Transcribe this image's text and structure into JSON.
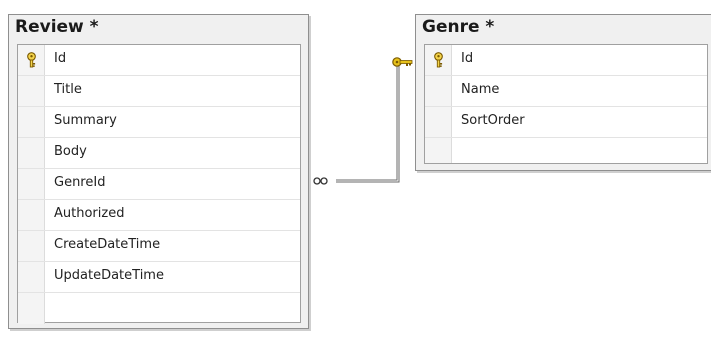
{
  "review": {
    "title": "Review *",
    "rows": [
      {
        "name": "Id",
        "primary_key": true
      },
      {
        "name": "Title",
        "primary_key": false
      },
      {
        "name": "Summary",
        "primary_key": false
      },
      {
        "name": "Body",
        "primary_key": false
      },
      {
        "name": "GenreId",
        "primary_key": false
      },
      {
        "name": "Authorized",
        "primary_key": false
      },
      {
        "name": "CreateDateTime",
        "primary_key": false
      },
      {
        "name": "UpdateDateTime",
        "primary_key": false
      }
    ]
  },
  "genre": {
    "title": "Genre *",
    "rows": [
      {
        "name": "Id",
        "primary_key": true
      },
      {
        "name": "Name",
        "primary_key": false
      },
      {
        "name": "SortOrder",
        "primary_key": false
      }
    ]
  },
  "relationship": {
    "many_end": "Review.GenreId",
    "one_end": "Genre.Id",
    "key_color": "#e8c21a"
  }
}
